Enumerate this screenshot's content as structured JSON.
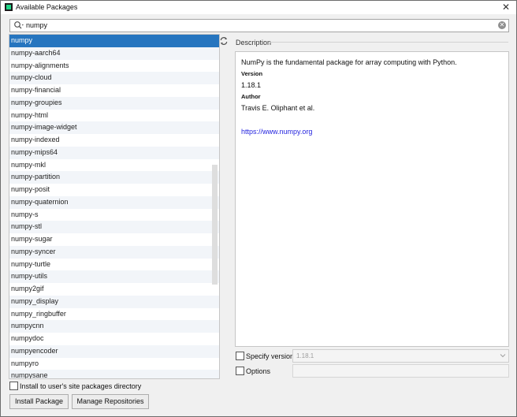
{
  "window": {
    "title": "Available Packages"
  },
  "search": {
    "value": "numpy"
  },
  "packages": {
    "items": [
      "numpy",
      "numpy-aarch64",
      "numpy-alignments",
      "numpy-cloud",
      "numpy-financial",
      "numpy-groupies",
      "numpy-html",
      "numpy-image-widget",
      "numpy-indexed",
      "numpy-mips64",
      "numpy-mkl",
      "numpy-partition",
      "numpy-posit",
      "numpy-quaternion",
      "numpy-s",
      "numpy-stl",
      "numpy-sugar",
      "numpy-syncer",
      "numpy-turtle",
      "numpy-utils",
      "numpy2gif",
      "numpy_display",
      "numpy_ringbuffer",
      "numpycnn",
      "numpydoc",
      "numpyencoder",
      "numpyro",
      "numpysane"
    ],
    "selected_index": 0
  },
  "description": {
    "label": "Description",
    "summary": "NumPy is the fundamental package for array computing with Python.",
    "version_heading": "Version",
    "version": "1.18.1",
    "author_heading": "Author",
    "author": "Travis E. Oliphant et al.",
    "url": "https://www.numpy.org"
  },
  "options": {
    "specify_version_label": "Specify version",
    "specify_version_value": "1.18.1",
    "options_label": "Options",
    "install_user_label": "Install to user's site packages directory"
  },
  "buttons": {
    "install": "Install Package",
    "manage": "Manage Repositories"
  },
  "colors": {
    "selection": "#2675bf",
    "link": "#1f1fde"
  },
  "icons": {
    "search": "search-icon",
    "clear": "clear-search-icon",
    "refresh": "refresh-icon",
    "close": "close-icon",
    "dropdown": "chevron-down-icon"
  }
}
